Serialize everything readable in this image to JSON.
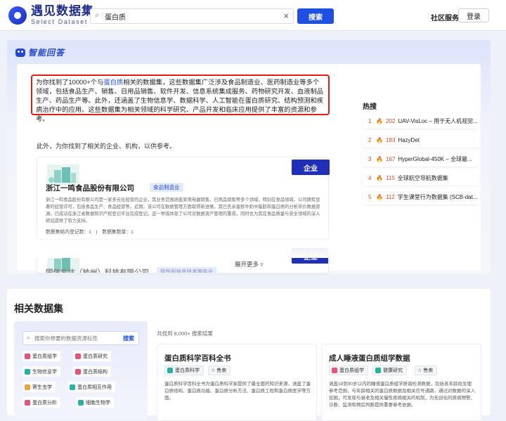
{
  "header": {
    "logo_title": "遇见数据集",
    "logo_subtitle": "Select Dataset",
    "search_value": "蛋白质",
    "search_button": "搜索",
    "community": "社区服务",
    "login": "登录"
  },
  "answer": {
    "section_title": "智能回答",
    "summary_pre": "为你找到了10000+个与",
    "summary_keyword": "蛋白质",
    "summary_post": "相关的数据集，这些数据集广泛涉及食品制造业、医药制造业等多个领域，包括食品生产、销售、日用品销售、软件开发、信息系统集成服务、药物研究开发、血液制品生产、药品生产等。此外，还涵盖了生物信息学、数据科学、人工智能在蛋白质研究、结构预测和疾病治疗中的应用。这些数据集为相关领域的科学研究、产品开发和临床应用提供了丰富的资源和参考。",
    "extra_line": "此外，为你找到了相关的企业、机构，以供参考。",
    "companies": [
      {
        "tag": "企业",
        "name": "浙江一鸣食品股份有限公司",
        "industry": "食品制造业",
        "description": "浙江一鸣食品股份有限公司是一家多元化经营的企业，其业务范围涵盖家用电器销售、日用品销售等多个领域，特别在食品领域，公司拥有显著的经营许可，包括食品生产、食品经营等。近期，该公司在数据管理方面取得新进展，其已氏亲蛋鲜牛奶中脂肪和蛋白质的分析评价数据资源，已成功在浙江省数据知识产权登记平台完成登记。这一举措体现了公司对数据资产管理的重视，同时也为其在食品质量与安全领域的深入研究提供了有力支持。",
        "stats": "数据集结内登记数：1　|　数据集数量：1"
      },
      {
        "tag": "企业",
        "name": "国信专达（杭州）科技有限公司",
        "industry": "软件和信息技术服务业"
      }
    ],
    "expand_more": "展开更多 ▿",
    "hot_title": "热搜",
    "hot_list": [
      {
        "rank": "1",
        "count": "202",
        "name": "UAV-VisLoc – 用于无人机视觉..."
      },
      {
        "rank": "2",
        "count": "183",
        "name": "HazyDet"
      },
      {
        "rank": "3",
        "count": "167",
        "name": "HyperGlobal-450K – 全球最..."
      },
      {
        "rank": "4",
        "count": "115",
        "name": "全球航空导航数据集"
      },
      {
        "rank": "5",
        "count": "112",
        "name": "学生课堂行为数据集 (SCB-dat..."
      }
    ]
  },
  "related": {
    "title": "相关数据集",
    "tag_search_placeholder": "搜索你想要的数据资源标签",
    "tag_search_button": "搜索",
    "tags": [
      {
        "label": "蛋白质组学",
        "color": "#e9507a"
      },
      {
        "label": "蛋白质研究",
        "color": "#e9507a"
      },
      {
        "label": "生物信息学",
        "color": "#26b3a3"
      },
      {
        "label": "蛋白质结构",
        "color": "#e9507a"
      },
      {
        "label": "寄生虫学",
        "color": "#f0a23a"
      },
      {
        "label": "蛋白质相互作用",
        "color": "#26b3a3"
      },
      {
        "label": "蛋白质分析",
        "color": "#e9507a"
      },
      {
        "label": "细胞生物学",
        "color": "#26b3a3"
      }
    ],
    "result_count": "共找到 8,000+ 搜索结果",
    "datasets": [
      {
        "title": "蛋白质科学百科全书",
        "tag1": "蛋白质科学",
        "tag2": "☆ 售卖",
        "description": "蛋白质科学百科全书为蛋白质科学家提供了最全面的知识来源，涵盖了蛋白质结构、蛋白质功能、蛋白质分析方法、蛋白质工程和蛋白质医学等方面。"
      },
      {
        "title": "成人睡液蛋白质组学数据",
        "tag1": "蛋白质组学",
        "tag2": "健康研究",
        "tag3": "☆ 售卖",
        "description": "涵盖18到90岁以内的睡液蛋白质组学质谱检测数据，包括各年龄段生理参考范围，与年龄相关的蛋白质数据及相关信号通路，通过对数据的深入挖掘，可发现与衰老及相关慢性疾病相关的机制，为无创化的疾病预警、诊断、监测和预后判断提供重要参考依据。"
      }
    ]
  }
}
